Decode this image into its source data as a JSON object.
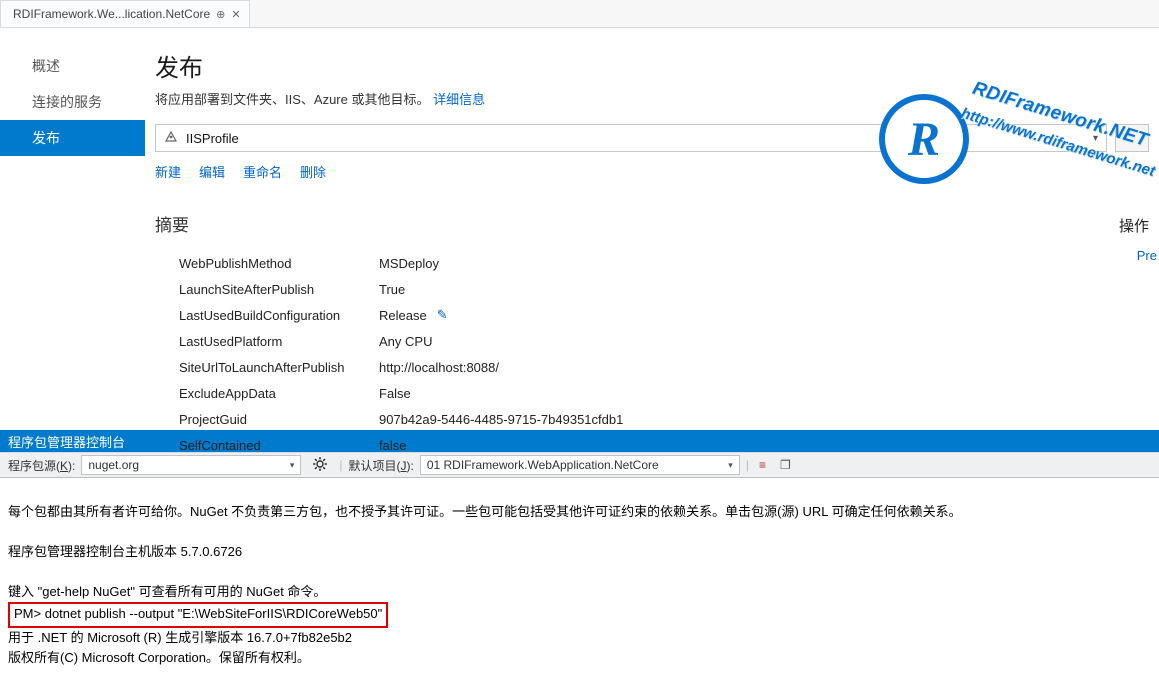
{
  "tab": {
    "title": "RDIFramework.We...lication.NetCore"
  },
  "sidebar": {
    "items": [
      {
        "label": "概述"
      },
      {
        "label": "连接的服务"
      },
      {
        "label": "发布"
      }
    ],
    "selected": 2
  },
  "publish": {
    "title": "发布",
    "subtitle_prefix": "将应用部署到文件夹、IIS、Azure 或其他目标。",
    "detail_link": "详细信息",
    "profile_value": "IISProfile",
    "actions": {
      "new": "新建",
      "edit": "编辑",
      "rename": "重命名",
      "delete": "删除"
    },
    "summary_label": "摘要",
    "ops_label": "操作",
    "preview_link": "Pre",
    "kv": [
      {
        "k": "WebPublishMethod",
        "v": "MSDeploy"
      },
      {
        "k": "LaunchSiteAfterPublish",
        "v": "True"
      },
      {
        "k": "LastUsedBuildConfiguration",
        "v": "Release",
        "editable": true
      },
      {
        "k": "LastUsedPlatform",
        "v": "Any CPU"
      },
      {
        "k": "SiteUrlToLaunchAfterPublish",
        "v": "http://localhost:8088/"
      },
      {
        "k": "ExcludeAppData",
        "v": "False"
      },
      {
        "k": "ProjectGuid",
        "v": "907b42a9-5446-4485-9715-7b49351cfdb1"
      },
      {
        "k": "SelfContained",
        "v": "false"
      }
    ]
  },
  "pm": {
    "title": "程序包管理器控制台",
    "src_label_pre": "程序包源(",
    "src_label_key": "K",
    "src_label_post": "):",
    "src_value": "nuget.org",
    "proj_label_pre": "默认项目(",
    "proj_label_key": "J",
    "proj_label_post": "):",
    "proj_value": "01 RDIFramework.WebApplication.NetCore",
    "lines": {
      "l1": "每个包都由其所有者许可给你。NuGet 不负责第三方包，也不授予其许可证。一些包可能包括受其他许可证约束的依赖关系。单击包源(源) URL 可确定任何依赖关系。",
      "l2": "程序包管理器控制台主机版本 5.7.0.6726",
      "l3": "键入 \"get-help NuGet\" 可查看所有可用的 NuGet 命令。",
      "prompt": "PM>",
      "cmd": "dotnet publish --output \"E:\\WebSiteForIIS\\RDICoreWeb50\"",
      "l5": "用于 .NET 的 Microsoft (R) 生成引擎版本 16.7.0+7fb82e5b2",
      "l6": "版权所有(C) Microsoft Corporation。保留所有权利。"
    }
  },
  "watermark": {
    "logo_letter": "R",
    "text": "RDIFramework.NET",
    "url": "http://www.rdiframework.net"
  }
}
